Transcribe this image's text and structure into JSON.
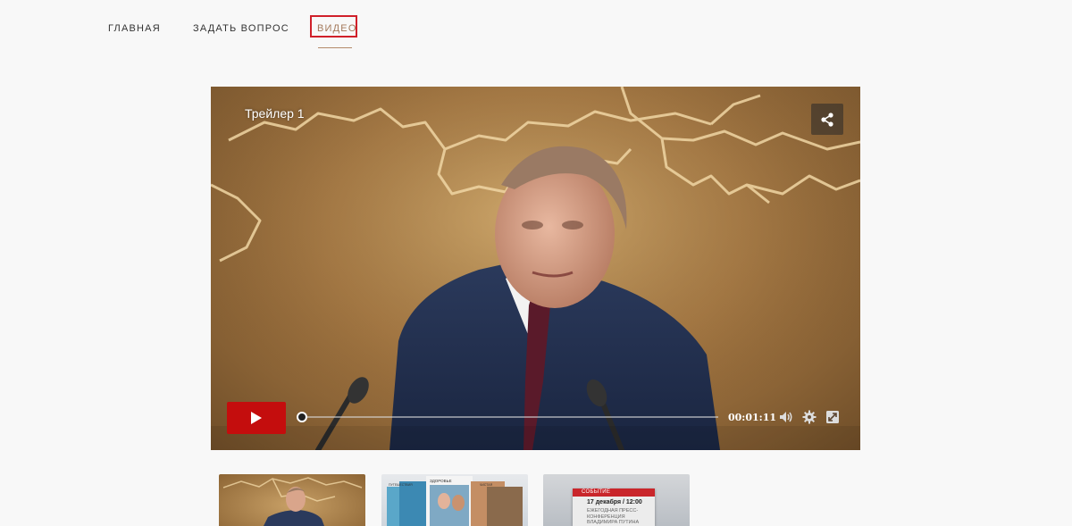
{
  "nav": {
    "items": [
      {
        "label": "ГЛАВНАЯ"
      },
      {
        "label": "ЗАДАТЬ ВОПРОС"
      },
      {
        "label": "ВИДЕО"
      }
    ],
    "active_index": 2
  },
  "player": {
    "title": "Трейлер 1",
    "time": "00:01:11",
    "progress": 0,
    "icons": {
      "share": "share-icon",
      "play": "play-icon",
      "volume": "volume-icon",
      "settings": "gear-icon",
      "fullscreen": "fullscreen-icon"
    }
  },
  "thumbnails": [
    {
      "icon": "video-thumbnail"
    },
    {
      "tags": [
        "ЗДОРОВЬЕ",
        "ПУТЕШЕСТВИЯ",
        "ЧИСТАЯ"
      ]
    },
    {
      "badge": "СОБЫТИЕ",
      "date": "17 декабря / 12:00",
      "text": "ЕЖЕГОДНАЯ ПРЕСС-КОНФЕРЕНЦИЯ ВЛАДИМИРА ПУТИНА"
    }
  ],
  "colors": {
    "accent_red": "#c40d0d",
    "highlight_box": "#d0202a",
    "active_nav": "#a3785a"
  }
}
